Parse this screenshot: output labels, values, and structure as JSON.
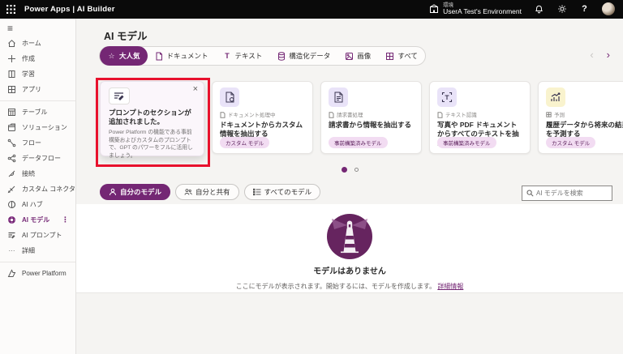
{
  "topbar": {
    "app_title": "Power Apps | AI Builder",
    "environment_label": "環境",
    "environment_name": "UserA Test's Environment"
  },
  "icons": {
    "hamburger": "≡",
    "close": "×",
    "chevron_left": "‹",
    "chevron_right": "›",
    "more_vertical": "⋮",
    "star": "☆",
    "plus": "+",
    "help": "?",
    "text_t": "T",
    "ellipsis": "···"
  },
  "sidebar": {
    "items": [
      {
        "label": "ホーム"
      },
      {
        "label": "作成"
      },
      {
        "label": "学習"
      },
      {
        "label": "アプリ"
      },
      {
        "label": "テーブル"
      },
      {
        "label": "ソリューション"
      },
      {
        "label": "フロー"
      },
      {
        "label": "データフロー"
      },
      {
        "label": "接続"
      },
      {
        "label": "カスタム コネクタ"
      },
      {
        "label": "AI ハブ"
      },
      {
        "label": "AI モデル",
        "selected": true
      },
      {
        "label": "AI プロンプト"
      },
      {
        "label": "詳細"
      }
    ],
    "footer_label": "Power Platform"
  },
  "main": {
    "title": "AI モデル",
    "category_tabs": [
      {
        "label": "大人気",
        "selected": true
      },
      {
        "label": "ドキュメント"
      },
      {
        "label": "テキスト"
      },
      {
        "label": "構造化データ"
      },
      {
        "label": "画像"
      },
      {
        "label": "すべて"
      }
    ],
    "callout": {
      "title": "プロンプトのセクションが追加されました。",
      "body": "Power Platform の機能である事前構築およびカスタムのプロンプトで、GPT のパワーをフルに活用しましょう。"
    },
    "cards": [
      {
        "category": "ドキュメント処理中",
        "title": "ドキュメントからカスタム情報を抽出する",
        "badge": "カスタム モデル"
      },
      {
        "category": "請求書処理",
        "title": "請求書から情報を抽出する",
        "badge": "事前構築済みモデル"
      },
      {
        "category": "テキスト認識",
        "title": "写真や PDF ドキュメントからすべてのテキストを抽出する (OCR)",
        "badge": "事前構築済みモデル"
      },
      {
        "category": "予測",
        "title": "履歴データから将来の結果を予測する",
        "badge": "カスタム モデル"
      }
    ],
    "model_tabs": [
      {
        "label": "自分のモデル",
        "selected": true
      },
      {
        "label": "自分と共有"
      },
      {
        "label": "すべてのモデル"
      }
    ],
    "search_placeholder": "AI モデルを検索",
    "empty_state": {
      "title": "モデルはありません",
      "body": "ここにモデルが表示されます。開始するには、モデルを作成します。",
      "link_label": "詳細情報"
    }
  },
  "colors": {
    "accent": "#742774",
    "topbar_bg": "#0a0a0a",
    "highlight_red": "#e8112d",
    "badge_bg": "#f2dcf2",
    "badge_text": "#5f255f",
    "card_icon_lavender": "#e9e3f8",
    "card_icon_yellow": "#f9f3ce"
  }
}
